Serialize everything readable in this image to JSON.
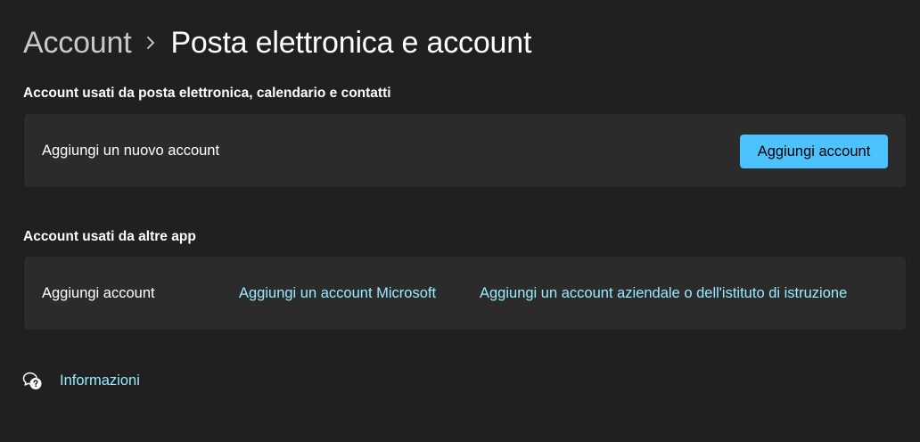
{
  "header": {
    "breadcrumb_parent": "Account",
    "breadcrumb_current": "Posta elettronica e account"
  },
  "email_section": {
    "title": "Account usati da posta elettronica, calendario e contatti",
    "row_label": "Aggiungi un nuovo account",
    "button_label": "Aggiungi account"
  },
  "other_apps_section": {
    "title": "Account usati da altre app",
    "row_label": "Aggiungi account",
    "link_microsoft": "Aggiungi un account Microsoft",
    "link_work": "Aggiungi un account aziendale o dell'istituto di istruzione"
  },
  "help": {
    "link_label": "Informazioni",
    "icon": "help-chat-icon"
  },
  "colors": {
    "background": "#202020",
    "card": "#2b2b2b",
    "accent": "#4cc2ff",
    "link": "#99ebff"
  }
}
